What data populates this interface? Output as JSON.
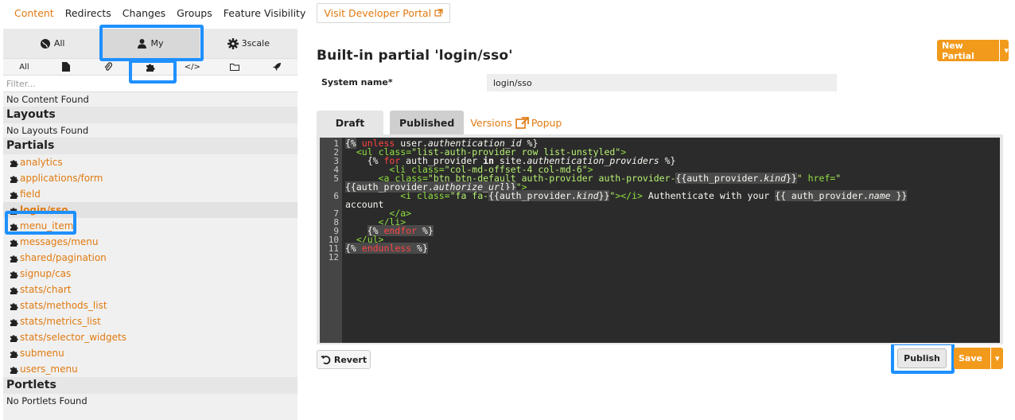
{
  "topnav": {
    "items": [
      "Content",
      "Redirects",
      "Changes",
      "Groups",
      "Feature Visibility"
    ],
    "dev_portal": "Visit Developer Portal"
  },
  "sidebar": {
    "scope": {
      "all": "All",
      "my": "My",
      "threescale": "3scale"
    },
    "types_all": "All",
    "filter_placeholder": "Filter...",
    "no_content": "No Content Found",
    "layouts_title": "Layouts",
    "no_layouts": "No Layouts Found",
    "partials_title": "Partials",
    "partials": [
      "analytics",
      "applications/form",
      "field",
      "login/sso",
      "menu_item",
      "messages/menu",
      "shared/pagination",
      "signup/cas",
      "stats/chart",
      "stats/methods_list",
      "stats/metrics_list",
      "stats/selector_widgets",
      "submenu",
      "users_menu"
    ],
    "selected_partial": "login/sso",
    "portlets_title": "Portlets",
    "no_portlets": "No Portlets Found"
  },
  "main": {
    "title": "Built-in partial 'login/sso'",
    "new_partial": "New Partial",
    "system_name_label": "System name*",
    "system_name_value": "login/sso",
    "tabs": {
      "draft": "Draft",
      "published": "Published",
      "versions": "Versions",
      "popup": "Popup"
    },
    "revert": "Revert",
    "publish": "Publish",
    "save": "Save"
  },
  "editor": {
    "line_numbers": [
      "1",
      "2",
      "3",
      "4",
      "5",
      "",
      "6",
      "",
      "7",
      "8",
      "9",
      "10",
      "11",
      "12"
    ]
  },
  "colors": {
    "accent": "#f29a1c",
    "link": "#e07a10",
    "highlight": "#1e90ff"
  }
}
